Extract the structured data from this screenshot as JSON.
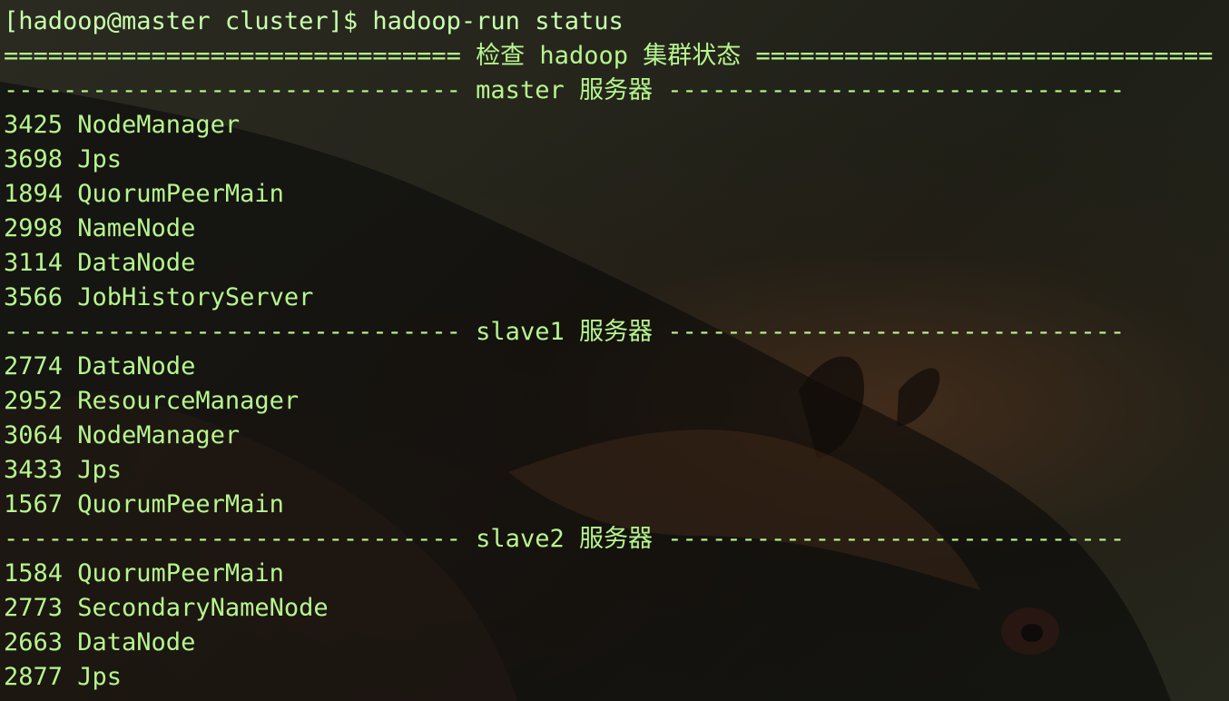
{
  "terminal": {
    "prompt_line": "[hadoop@master cluster]$ hadoop-run status",
    "title_line": "=============================== 检查 hadoop 集群状态 ===============================",
    "sections": [
      {
        "header": "------------------------------- master 服务器 -------------------------------",
        "processes": [
          "3425 NodeManager",
          "3698 Jps",
          "1894 QuorumPeerMain",
          "2998 NameNode",
          "3114 DataNode",
          "3566 JobHistoryServer"
        ]
      },
      {
        "header": "------------------------------- slave1 服务器 -------------------------------",
        "processes": [
          "2774 DataNode",
          "2952 ResourceManager",
          "3064 NodeManager",
          "3433 Jps",
          "1567 QuorumPeerMain"
        ]
      },
      {
        "header": "------------------------------- slave2 服务器 -------------------------------",
        "processes": [
          "1584 QuorumPeerMain",
          "2773 SecondaryNameNode",
          "2663 DataNode",
          "2877 Jps"
        ]
      }
    ]
  },
  "colors": {
    "text": "#b7f58e",
    "background": "#24241b"
  }
}
